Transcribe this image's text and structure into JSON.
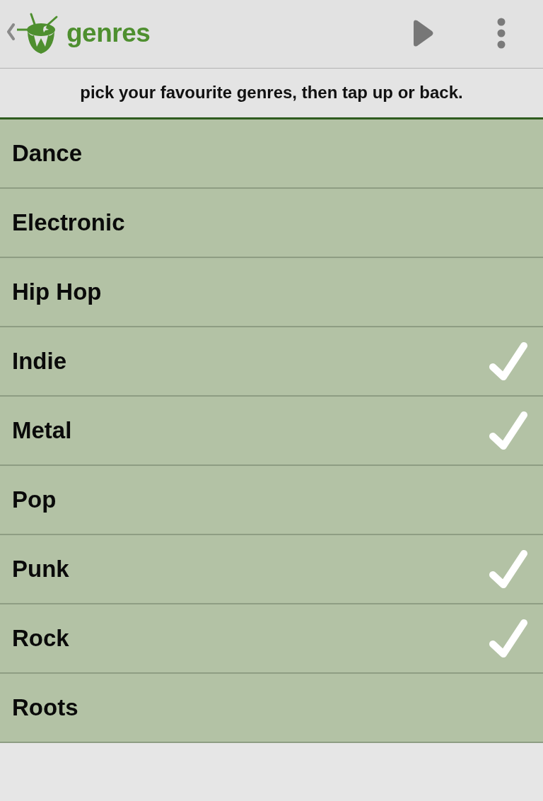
{
  "app_bar": {
    "title": "genres"
  },
  "instruction": "pick your favourite genres, then tap up or back.",
  "genres": [
    {
      "label": "Dance",
      "checked": false
    },
    {
      "label": "Electronic",
      "checked": false
    },
    {
      "label": "Hip Hop",
      "checked": false
    },
    {
      "label": "Indie",
      "checked": true
    },
    {
      "label": "Metal",
      "checked": true
    },
    {
      "label": "Pop",
      "checked": false
    },
    {
      "label": "Punk",
      "checked": true
    },
    {
      "label": "Rock",
      "checked": true
    },
    {
      "label": "Roots",
      "checked": false
    }
  ]
}
